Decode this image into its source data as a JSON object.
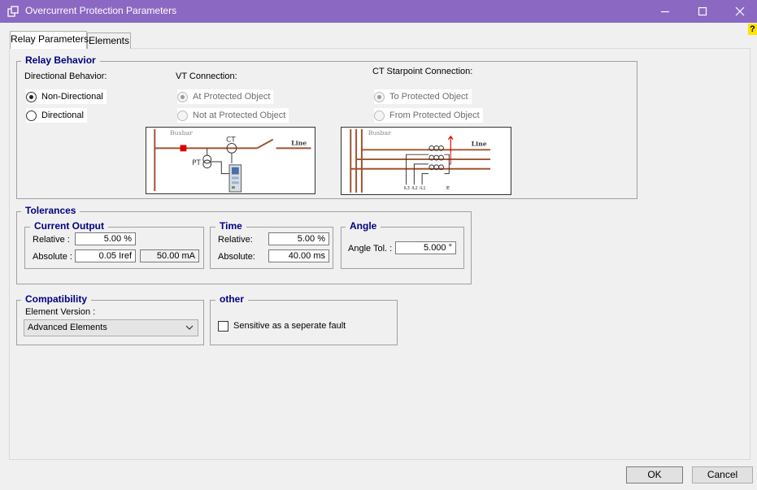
{
  "window": {
    "title": "Overcurrent Protection Parameters",
    "help": "?"
  },
  "tabs": [
    {
      "label": "Relay Parameters",
      "active": true
    },
    {
      "label": "Elements",
      "active": false
    }
  ],
  "relay_behavior": {
    "legend": "Relay Behavior",
    "directional_label": "Directional Behavior:",
    "directional_options": [
      {
        "label": "Non-Directional",
        "checked": true
      },
      {
        "label": "Directional",
        "checked": false
      }
    ],
    "vt_label": "VT Connection:",
    "vt_options": [
      {
        "label": "At Protected Object",
        "checked": true,
        "disabled": true
      },
      {
        "label": "Not at Protected Object",
        "checked": false,
        "disabled": true
      }
    ],
    "ct_label": "CT Starpoint Connection:",
    "ct_options": [
      {
        "label": "To Protected Object",
        "checked": true,
        "disabled": true
      },
      {
        "label": "From Protected Object",
        "checked": false,
        "disabled": true
      }
    ],
    "vt_diagram": {
      "busbar": "Busbar",
      "line": "Line",
      "ct": "CT",
      "pt": "PT"
    },
    "ct_diagram": {
      "busbar": "Busbar",
      "line": "Line",
      "terminals": [
        "IL3",
        "IL2",
        "IL1",
        "IE"
      ]
    }
  },
  "tolerances": {
    "legend": "Tolerances",
    "current_output": {
      "legend": "Current Output",
      "relative_label": "Relative :",
      "relative_value": "5.00 %",
      "absolute_label": "Absolute :",
      "absolute_value": "0.05 Iref",
      "absolute_value_ma": "50.00 mA"
    },
    "time": {
      "legend": "Time",
      "relative_label": "Relative:",
      "relative_value": "5.00 %",
      "absolute_label": "Absolute:",
      "absolute_value": "40.00 ms"
    },
    "angle": {
      "legend": "Angle",
      "tol_label": "Angle Tol. :",
      "tol_value": "5.000 °"
    }
  },
  "compatibility": {
    "legend": "Compatibility",
    "element_version_label": "Element Version :",
    "element_version_value": "Advanced Elements"
  },
  "other": {
    "legend": "other",
    "sensitive_label": "Sensitive as a seperate fault",
    "sensitive_checked": false
  },
  "buttons": {
    "ok": "OK",
    "cancel": "Cancel"
  },
  "colors": {
    "titlebar": "#8b68c2",
    "legend_text": "#000080",
    "busbar_line": "#a0522d",
    "help_badge": "#ffe400"
  }
}
